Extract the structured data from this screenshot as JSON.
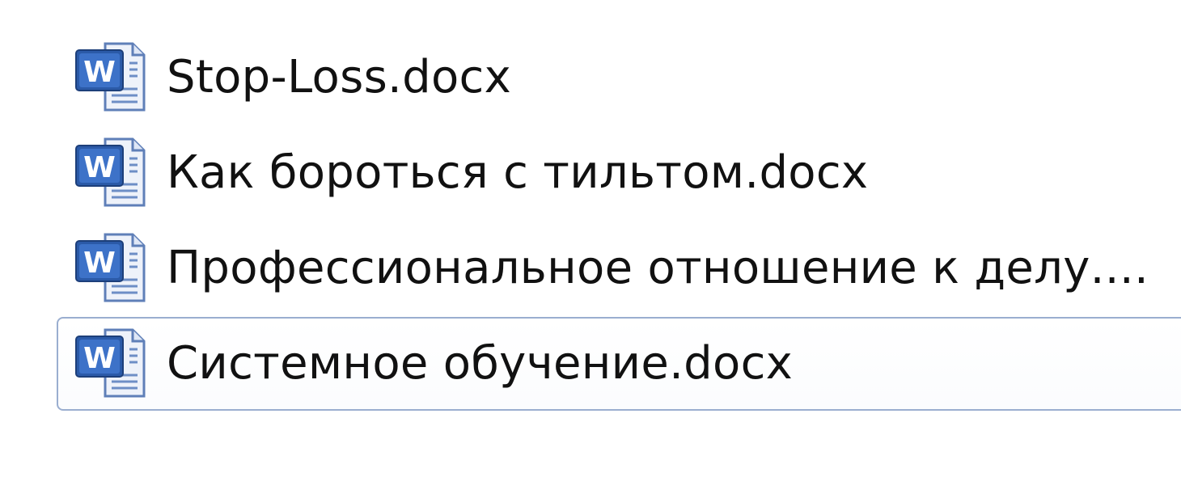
{
  "files": [
    {
      "name": "Stop-Loss.docx",
      "icon": "word-document-icon",
      "selected": false
    },
    {
      "name": "Как бороться с тильтом.docx",
      "icon": "word-document-icon",
      "selected": false
    },
    {
      "name": "Профессиональное отношение к делу....",
      "icon": "word-document-icon",
      "selected": false
    },
    {
      "name": "Системное обучение.docx",
      "icon": "word-document-icon",
      "selected": true
    }
  ],
  "colors": {
    "selection_border": "#9aaed0",
    "icon_blue": "#2b5aa8",
    "text": "#111111"
  }
}
